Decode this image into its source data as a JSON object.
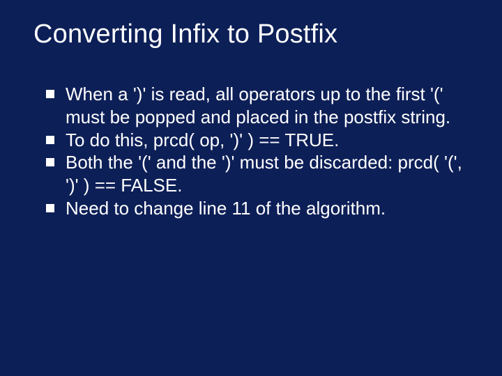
{
  "slide": {
    "title": "Converting Infix to Postfix",
    "bullets": [
      "When a ')' is read, all operators up to the first '(' must be popped and placed in the postfix string.",
      "To do this, prcd( op, ')' ) == TRUE.",
      "Both the '(' and the ')' must be discarded: prcd( '(', ')' ) == FALSE.",
      "Need to change line 11 of the algorithm."
    ]
  }
}
